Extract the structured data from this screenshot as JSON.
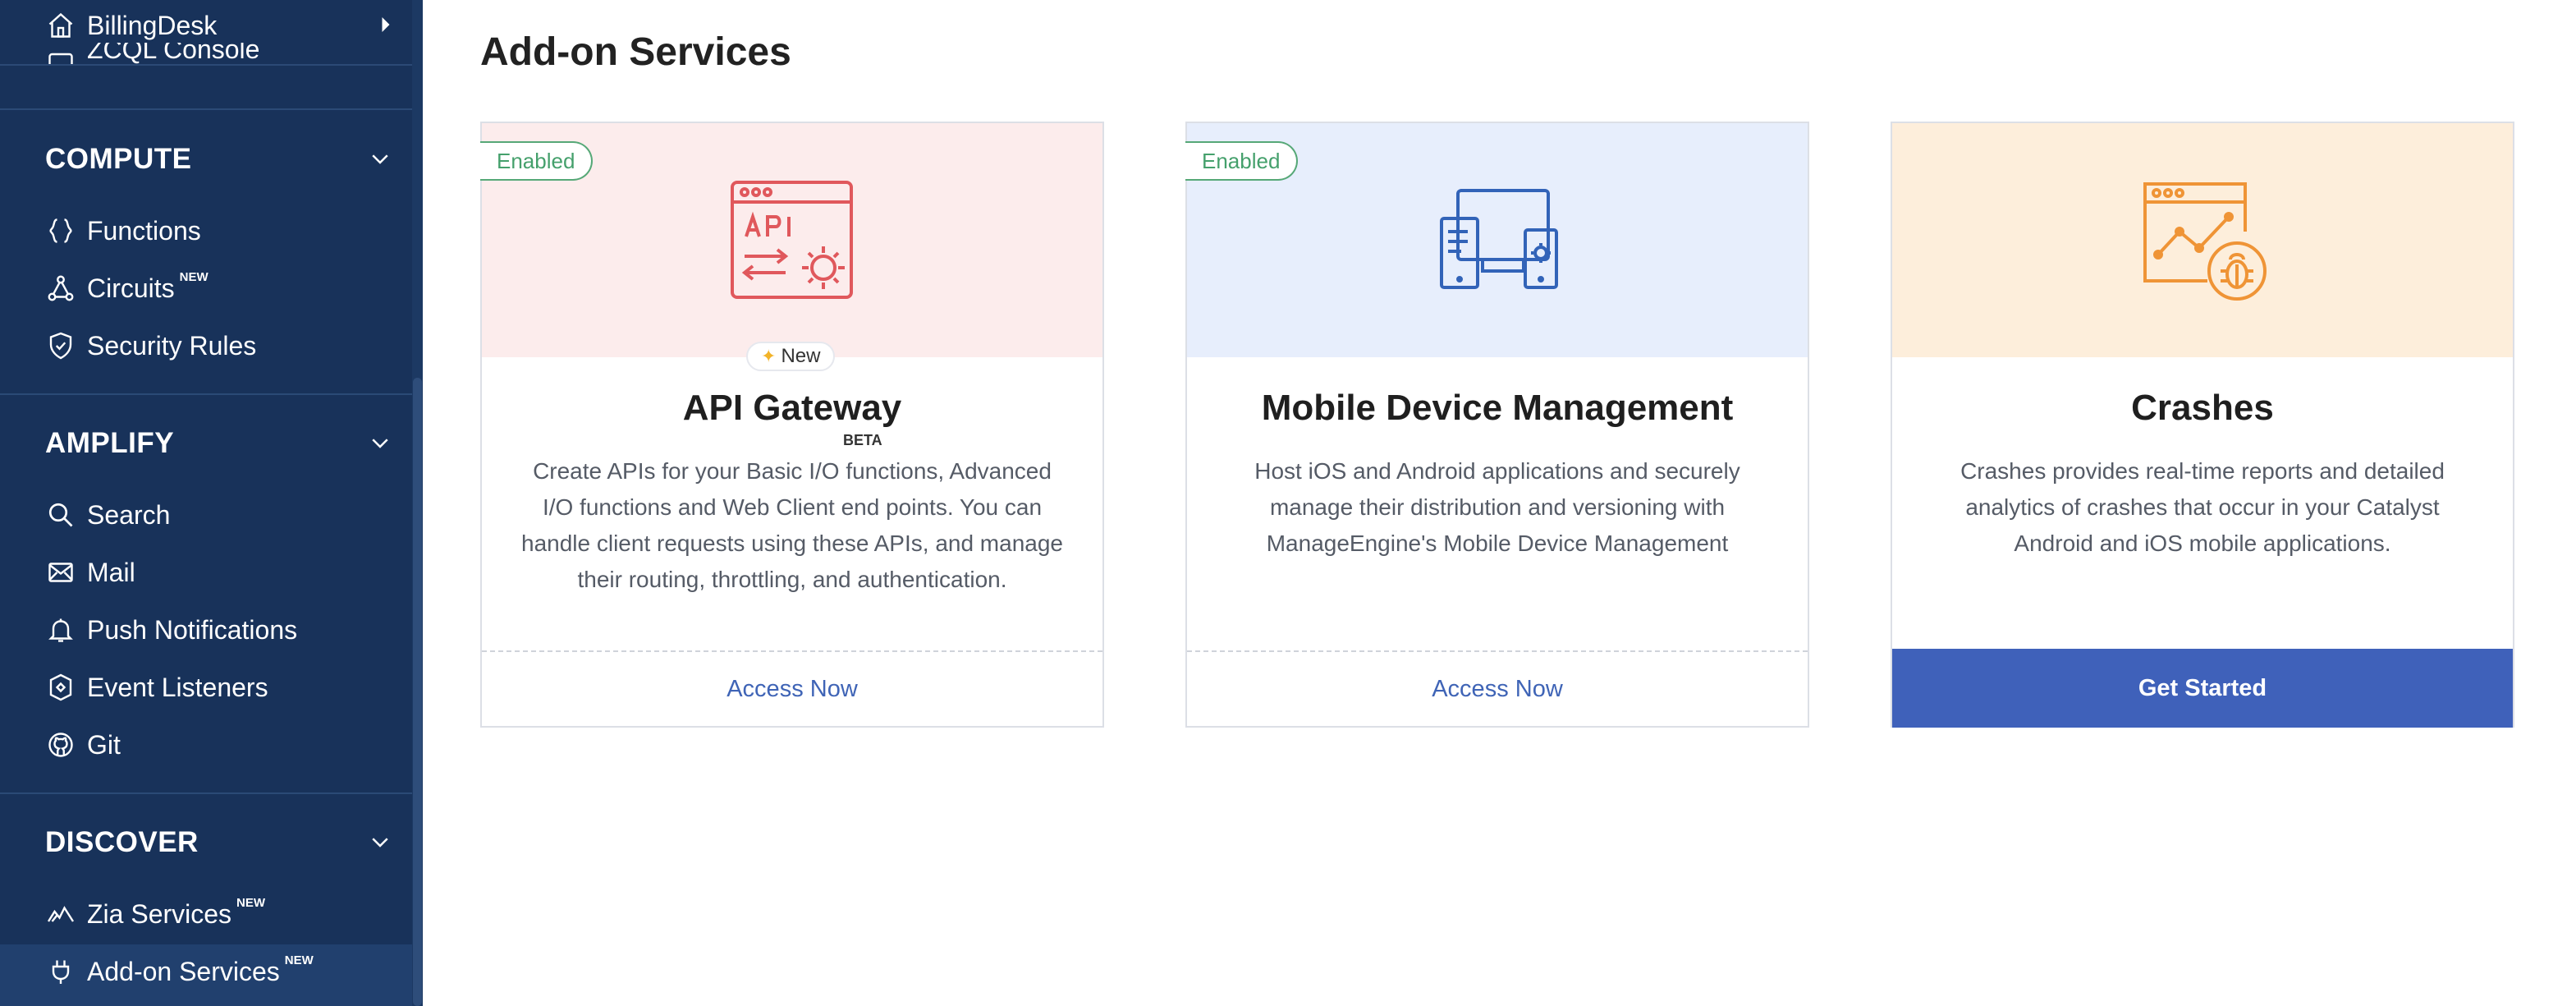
{
  "sidebar": {
    "top_item": {
      "label": "BillingDesk",
      "icon": "home-icon"
    },
    "partial_item": {
      "label": "ZCQL Console",
      "icon": "console-icon"
    },
    "sections": [
      {
        "title": "COMPUTE",
        "items": [
          {
            "label": "Functions",
            "icon": "braces-icon",
            "new": ""
          },
          {
            "label": "Circuits",
            "icon": "circuits-icon",
            "new": "NEW"
          },
          {
            "label": "Security Rules",
            "icon": "shield-icon",
            "new": ""
          }
        ]
      },
      {
        "title": "AMPLIFY",
        "items": [
          {
            "label": "Search",
            "icon": "search-icon",
            "new": ""
          },
          {
            "label": "Mail",
            "icon": "mail-icon",
            "new": ""
          },
          {
            "label": "Push Notifications",
            "icon": "bell-icon",
            "new": ""
          },
          {
            "label": "Event Listeners",
            "icon": "event-icon",
            "new": ""
          },
          {
            "label": "Git",
            "icon": "github-icon",
            "new": ""
          }
        ]
      },
      {
        "title": "DISCOVER",
        "items": [
          {
            "label": "Zia Services",
            "icon": "zia-icon",
            "new": "NEW"
          },
          {
            "label": "Add-on Services",
            "icon": "plug-icon",
            "new": "NEW"
          }
        ]
      }
    ]
  },
  "page": {
    "title": "Add-on Services"
  },
  "cards": [
    {
      "title": "API Gateway",
      "beta": "BETA",
      "enabled_badge": "Enabled",
      "new_badge": "New",
      "hero_color": "#fcecec",
      "icon": "api-gateway-icon",
      "description": "Create APIs for your Basic I/O functions, Advanced I/O functions and Web Client end points. You can handle client requests using these APIs, and manage their routing, throttling, and authentication.",
      "action": "Access Now"
    },
    {
      "title": "Mobile Device Management",
      "enabled_badge": "Enabled",
      "hero_color": "#e7eefc",
      "icon": "devices-icon",
      "description": "Host iOS and Android applications and securely manage their distribution and versioning with ManageEngine's Mobile Device Management",
      "action": "Access Now"
    },
    {
      "title": "Crashes",
      "hero_color": "#fdeedb",
      "icon": "crash-report-icon",
      "description": "Crashes provides real-time reports and detailed analytics of crashes that occur in your Catalyst Android and iOS mobile applications.",
      "action": "Get Started"
    }
  ],
  "colors": {
    "sidebar_bg": "#18325a",
    "accent": "#3f61ba",
    "enabled_green": "#45a06c",
    "api_red": "#e0585c",
    "mdm_blue": "#3263b8",
    "crash_orange": "#ef9436"
  }
}
